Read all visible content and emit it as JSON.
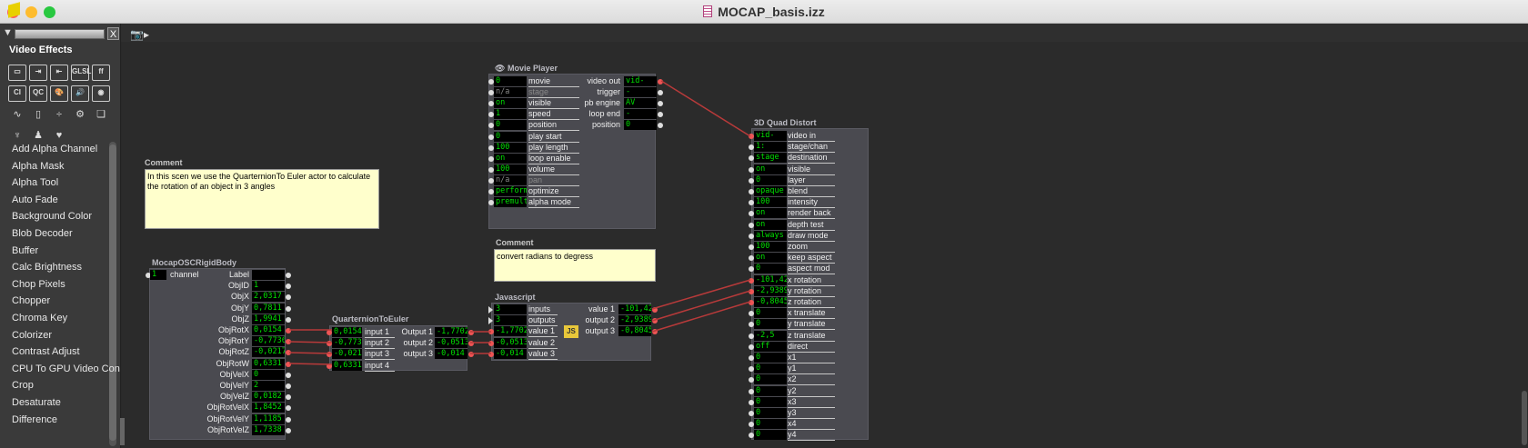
{
  "window": {
    "title": "MOCAP_basis.izz",
    "traffic": [
      "#ff5f57",
      "#febc2e",
      "#28c840"
    ]
  },
  "sidebar": {
    "close_label": "X",
    "heading": "Video Effects",
    "icons": [
      {
        "name": "video-frame-icon",
        "glyph": "▭"
      },
      {
        "name": "video-in-icon",
        "glyph": "⇥"
      },
      {
        "name": "video-out-icon",
        "glyph": "⇤"
      },
      {
        "name": "glsl-icon",
        "glyph": "GLSL"
      },
      {
        "name": "ff-icon",
        "glyph": "ff"
      },
      {
        "name": "ci-icon",
        "glyph": "CI"
      },
      {
        "name": "qc-icon",
        "glyph": "QC"
      },
      {
        "name": "palette-icon",
        "glyph": "🎨"
      },
      {
        "name": "speaker-icon",
        "glyph": "🔊"
      },
      {
        "name": "color-wheel-icon",
        "glyph": "◉"
      },
      {
        "name": "wave-icon",
        "glyph": "∿"
      },
      {
        "name": "mouse-icon",
        "glyph": "▯"
      },
      {
        "name": "divide-icon",
        "glyph": "÷"
      },
      {
        "name": "gear-icon",
        "glyph": "⚙"
      },
      {
        "name": "layers-icon",
        "glyph": "❏"
      },
      {
        "name": "antenna-icon",
        "glyph": "♆"
      },
      {
        "name": "person-icon",
        "glyph": "♟"
      },
      {
        "name": "heart-icon",
        "glyph": "♥"
      }
    ],
    "items": [
      "Add Alpha Channel",
      "Alpha Mask",
      "Alpha Tool",
      "Auto Fade",
      "Background Color",
      "Blob Decoder",
      "Buffer",
      "Calc Brightness",
      "Chop Pixels",
      "Chopper",
      "Chroma Key",
      "Colorizer",
      "Contrast Adjust",
      "CPU To GPU Video Con",
      "Crop",
      "Desaturate",
      "Difference"
    ]
  },
  "comment1": {
    "title": "Comment",
    "text": "In this scen we use the QuarternionTo Euler actor to calculate the rotation of an object in 3 angles"
  },
  "comment2": {
    "title": "Comment",
    "text": "convert radians to degress"
  },
  "movie_player": {
    "title": "Movie Player",
    "inputs": [
      {
        "v": "0",
        "l": "movie"
      },
      {
        "v": "n/a",
        "l": "stage",
        "dim": true
      },
      {
        "v": "on",
        "l": "visible"
      },
      {
        "v": "1",
        "l": "speed"
      },
      {
        "v": "0",
        "l": "position"
      },
      {
        "v": "0",
        "l": "play start"
      },
      {
        "v": "100",
        "l": "play length"
      },
      {
        "v": "on",
        "l": "loop enable"
      },
      {
        "v": "100",
        "l": "volume"
      },
      {
        "v": "n/a",
        "l": "pan",
        "dim": true
      },
      {
        "v": "perform",
        "l": "optimize"
      },
      {
        "v": "premult",
        "l": "alpha mode"
      }
    ],
    "outputs": [
      {
        "l": "video out",
        "v": "vid-gpu"
      },
      {
        "l": "trigger",
        "v": "-"
      },
      {
        "l": "pb engine",
        "v": "AV"
      },
      {
        "l": "loop end",
        "v": "-"
      },
      {
        "l": "position",
        "v": "0"
      }
    ]
  },
  "mocap": {
    "title": "MocapOSCRigidBody",
    "channel": {
      "v": "1",
      "l": "channel"
    },
    "outputs": [
      {
        "l": "Label",
        "v": ""
      },
      {
        "l": "ObjID",
        "v": "1"
      },
      {
        "l": "ObjX",
        "v": "2,0317"
      },
      {
        "l": "ObjY",
        "v": "0,7811"
      },
      {
        "l": "ObjZ",
        "v": "1,9941"
      },
      {
        "l": "ObjRotX",
        "v": "0,0154"
      },
      {
        "l": "ObjRotY",
        "v": "-0,7736"
      },
      {
        "l": "ObjRotZ",
        "v": "-0,0217"
      },
      {
        "l": "ObjRotW",
        "v": "0,6331"
      },
      {
        "l": "ObjVelX",
        "v": "0"
      },
      {
        "l": "ObjVelY",
        "v": "2"
      },
      {
        "l": "ObjVelZ",
        "v": "0,0182"
      },
      {
        "l": "ObjRotVelX",
        "v": "1,8452"
      },
      {
        "l": "ObjRotVelY",
        "v": "1,1185"
      },
      {
        "l": "ObjRotVelZ",
        "v": "1,7338"
      }
    ]
  },
  "quat": {
    "title": "QuarternionToEuler",
    "inputs": [
      {
        "v": "0,0154",
        "l": "input 1"
      },
      {
        "v": "-0,7736",
        "l": "input 2"
      },
      {
        "v": "-0,0217",
        "l": "input 3"
      },
      {
        "v": "0,6331",
        "l": "input 4"
      }
    ],
    "outputs": [
      {
        "l": "Output 1",
        "v": "-1,7702"
      },
      {
        "l": "output 2",
        "v": "-0,0513"
      },
      {
        "l": "output 3",
        "v": "-0,014"
      }
    ]
  },
  "js": {
    "title": "Javascript",
    "badge": "JS",
    "inputs": [
      {
        "v": "3",
        "l": "inputs"
      },
      {
        "v": "3",
        "l": "outputs"
      },
      {
        "v": "-1,7702",
        "l": "value 1"
      },
      {
        "v": "-0,0513",
        "l": "value 2"
      },
      {
        "v": "-0,014",
        "l": "value 3"
      }
    ],
    "outputs": [
      {
        "l": "value 1",
        "v": "-101,42"
      },
      {
        "l": "output 2",
        "v": "-2,9389"
      },
      {
        "l": "output 3",
        "v": "-0,8045"
      }
    ]
  },
  "quad": {
    "title": "3D Quad Distort",
    "inputs": [
      {
        "v": "vid-gpu",
        "l": "video in"
      },
      {
        "v": "1: Stage",
        "l": "stage/chan"
      },
      {
        "v": "stage",
        "l": "destination"
      },
      {
        "v": "on",
        "l": "visible"
      },
      {
        "v": "0",
        "l": "layer"
      },
      {
        "v": "opaque",
        "l": "blend"
      },
      {
        "v": "100",
        "l": "intensity"
      },
      {
        "v": "on",
        "l": "render back"
      },
      {
        "v": "on",
        "l": "depth test"
      },
      {
        "v": "always",
        "l": "draw mode"
      },
      {
        "v": "100",
        "l": "zoom"
      },
      {
        "v": "on",
        "l": "keep aspect"
      },
      {
        "v": "0",
        "l": "aspect mod"
      },
      {
        "v": "-101,42",
        "l": "x rotation"
      },
      {
        "v": "-2,9389",
        "l": "y rotation"
      },
      {
        "v": "-0,8045",
        "l": "z rotation"
      },
      {
        "v": "0",
        "l": "x translate"
      },
      {
        "v": "0",
        "l": "y translate"
      },
      {
        "v": "-2,5",
        "l": "z translate"
      },
      {
        "v": "off",
        "l": "direct"
      },
      {
        "v": "0",
        "l": "x1"
      },
      {
        "v": "0",
        "l": "y1"
      },
      {
        "v": "0",
        "l": "x2"
      },
      {
        "v": "0",
        "l": "y2"
      },
      {
        "v": "0",
        "l": "x3"
      },
      {
        "v": "0",
        "l": "y3"
      },
      {
        "v": "0",
        "l": "x4"
      },
      {
        "v": "0",
        "l": "y4"
      }
    ]
  }
}
